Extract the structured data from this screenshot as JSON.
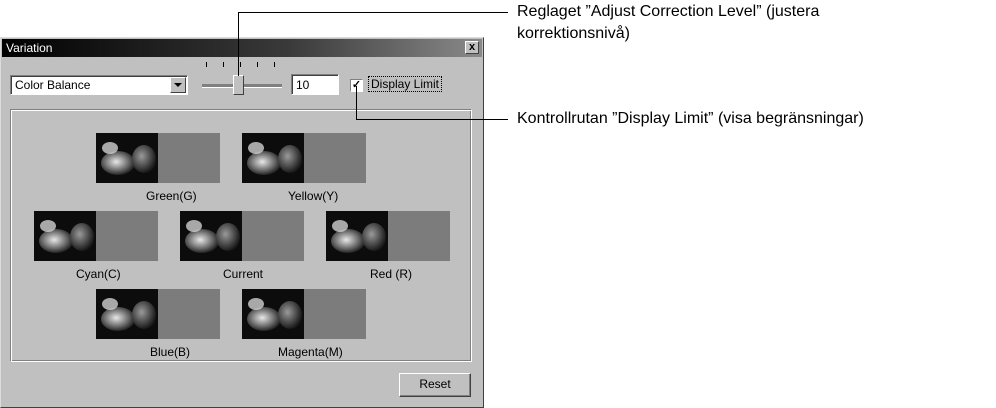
{
  "window": {
    "title": "Variation",
    "close_glyph": "x"
  },
  "controls": {
    "mode_select_value": "Color Balance",
    "correction_level": "10",
    "display_limit_checked": true,
    "display_limit_label": "Display Limit"
  },
  "variations": [
    {
      "label": "Green(G)"
    },
    {
      "label": "Yellow(Y)"
    },
    {
      "label": "Cyan(C)"
    },
    {
      "label": "Current"
    },
    {
      "label": "Red (R)"
    },
    {
      "label": "Blue(B)"
    },
    {
      "label": "Magenta(M)"
    }
  ],
  "buttons": {
    "reset": "Reset"
  },
  "callouts": {
    "slider_line1": "Reglaget ”Adjust Correction Level” (justera",
    "slider_line2": "korrektionsnivå)",
    "checkbox": "Kontrollrutan ”Display Limit” (visa begränsningar)"
  },
  "colors": {
    "dialog_bg": "#c0c0c0",
    "titlebar_start": "#000000",
    "titlebar_end": "#8a8a8a",
    "swatch_gray": "#7c7c7c"
  },
  "icons": {
    "close": "close-icon",
    "dropdown": "chevron-down-icon",
    "check": "checkmark-icon"
  }
}
